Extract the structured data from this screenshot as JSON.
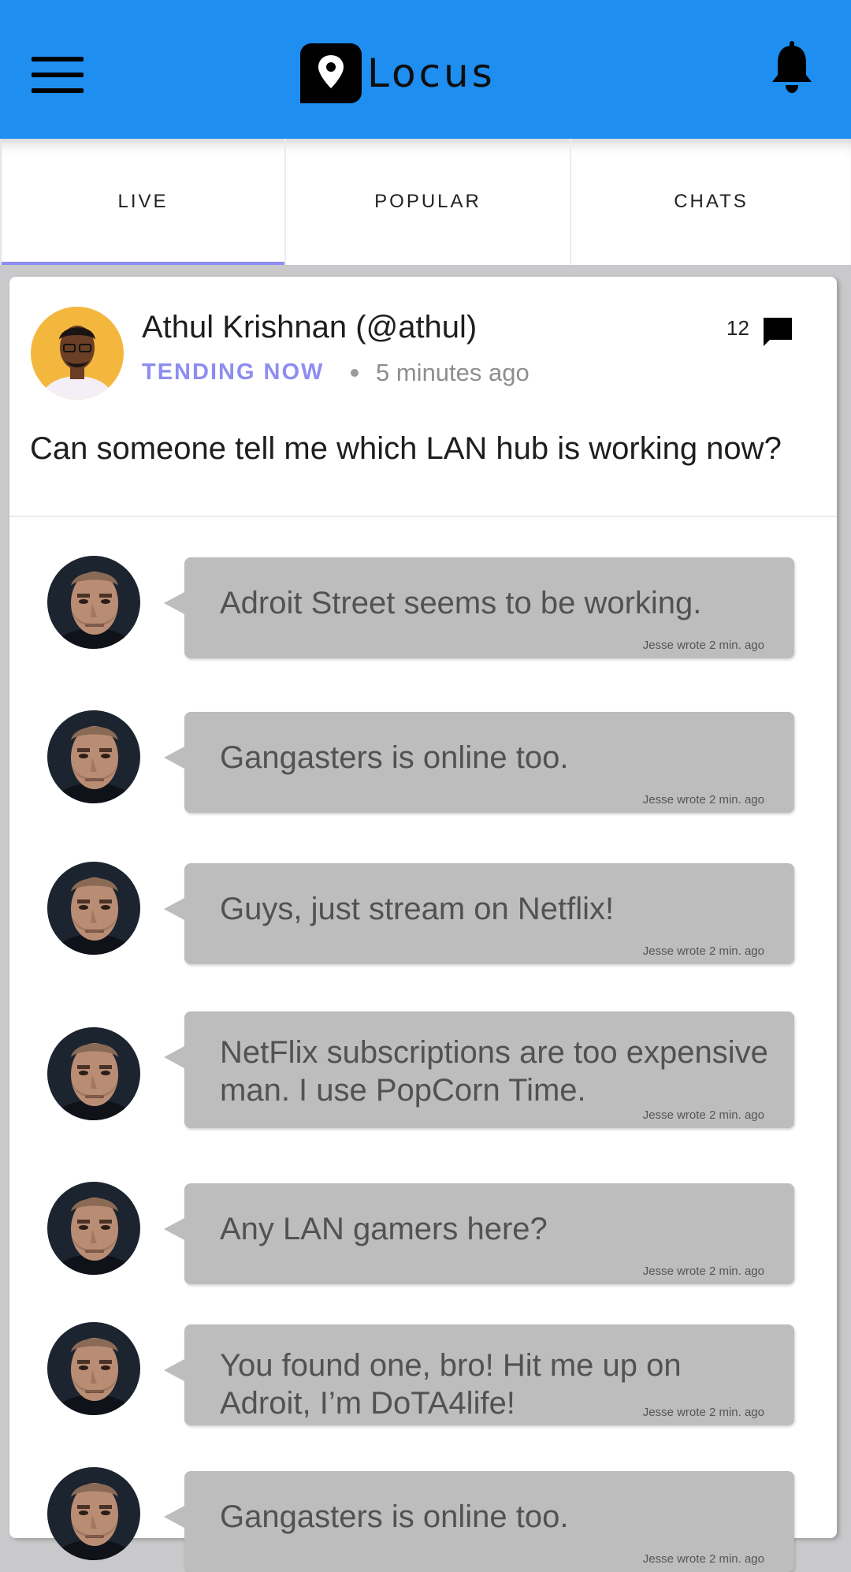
{
  "app": {
    "title": "Locus",
    "accent_color": "#1e8ef0",
    "tab_indicator_color": "#8e8cf6"
  },
  "tabs": [
    {
      "label": "LIVE",
      "active": true
    },
    {
      "label": "POPULAR",
      "active": false
    },
    {
      "label": "CHATS",
      "active": false
    }
  ],
  "post": {
    "author": "Athul Krishnan (@athul)",
    "badge": "TENDING NOW",
    "time": "5 minutes ago",
    "comment_count": "12",
    "text": "Can someone tell me which LAN hub is working now?"
  },
  "comments": [
    {
      "text": "Adroit Street seems to be working.",
      "meta": "Jesse wrote 2 min. ago"
    },
    {
      "text": "Gangasters is online too.",
      "meta": "Jesse wrote 2 min. ago"
    },
    {
      "text": "Guys, just stream on Netflix!",
      "meta": "Jesse wrote 2 min. ago"
    },
    {
      "text": "NetFlix subscriptions are too expensive man. I use PopCorn Time.",
      "meta": "Jesse wrote 2 min. ago"
    },
    {
      "text": "Any LAN gamers here?",
      "meta": "Jesse wrote 2 min. ago"
    },
    {
      "text": "You found one, bro! Hit me up on Adroit, I’m DoTA4life!",
      "meta": "Jesse wrote 2 min. ago"
    },
    {
      "text": "Gangasters is online too.",
      "meta": "Jesse wrote 2 min. ago"
    }
  ],
  "icons": {
    "menu": "hamburger-menu-icon",
    "logo": "map-pin-chat-icon",
    "notifications": "bell-icon",
    "comments": "comment-bubble-icon"
  }
}
